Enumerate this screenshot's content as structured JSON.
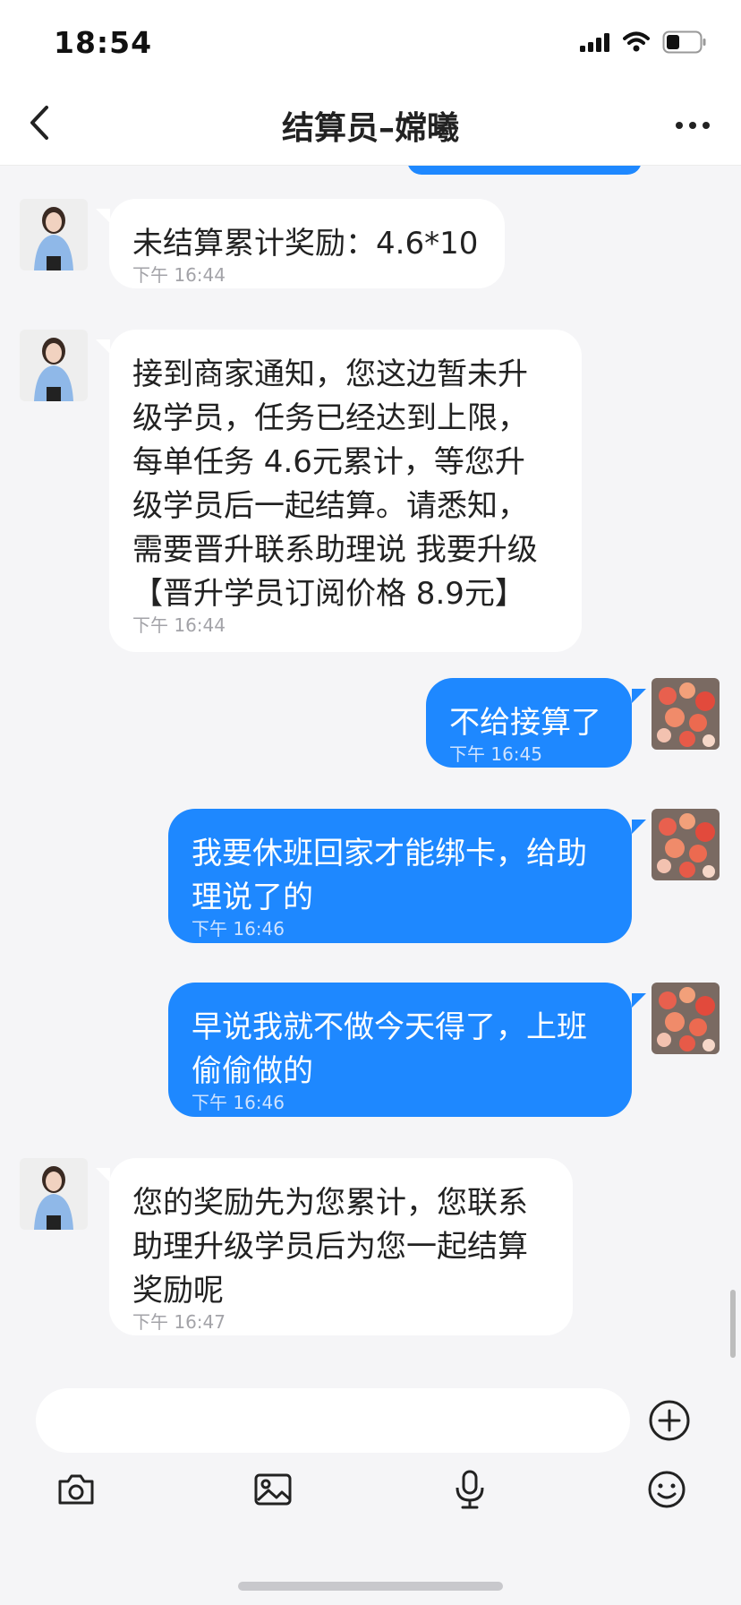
{
  "status_bar": {
    "time": "18:54",
    "icons": [
      "cellular-signal-icon",
      "wifi-icon",
      "battery-icon"
    ]
  },
  "header": {
    "title": "结算员–嫦曦",
    "back_icon": "chevron-left-icon",
    "more_icon": "more-dots-icon"
  },
  "messages": [
    {
      "direction": "in",
      "text": "未结算累计奖励：4.6*10",
      "time": "下午 16:44"
    },
    {
      "direction": "in",
      "text": "接到商家通知，您这边暂未升\n级学员，任务已经达到上限，\n每单任务 4.6元累计，等您升\n级学员后一起结算。请悉知，\n需要晋升联系助理说 我要升级\n【晋升学员订阅价格 8.9元】",
      "time": "下午 16:44"
    },
    {
      "direction": "out",
      "text": "不给接算了",
      "time": "下午 16:45"
    },
    {
      "direction": "out",
      "text": "我要休班回家才能绑卡，给助\n理说了的",
      "time": "下午 16:46"
    },
    {
      "direction": "out",
      "text": "早说我就不做今天得了，上班\n偷偷做的",
      "time": "下午 16:46"
    },
    {
      "direction": "in",
      "text": "您的奖励先为您累计，您联系\n助理升级学员后为您一起结算\n奖励呢",
      "time": "下午 16:47"
    }
  ],
  "input": {
    "value": "",
    "placeholder": "",
    "plus_icon": "plus-circle-icon",
    "toolbar_icons": [
      "camera-icon",
      "image-icon",
      "microphone-icon",
      "emoji-icon"
    ]
  },
  "colors": {
    "outgoing_bubble": "#1e88ff",
    "incoming_bubble": "#ffffff",
    "background": "#f5f5f7"
  }
}
